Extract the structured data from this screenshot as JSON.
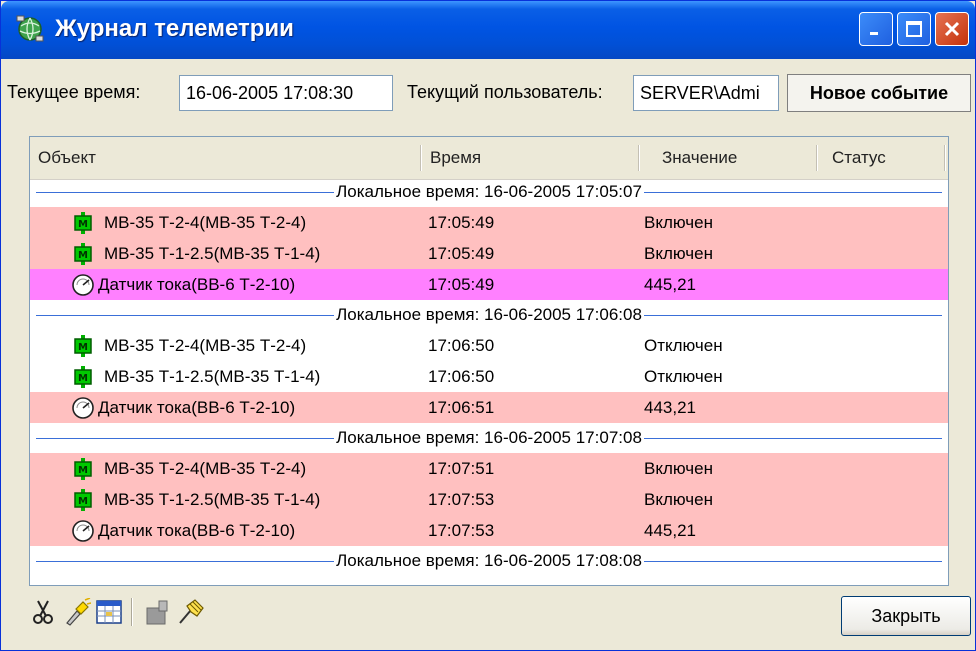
{
  "window": {
    "title": "Журнал телеметрии",
    "icons": {
      "app": "globe-network-icon",
      "minimize": "minimize-icon",
      "maximize": "maximize-icon",
      "close": "close-x-icon"
    }
  },
  "top": {
    "current_time_label": "Текущее время:",
    "current_time_value": "16-06-2005 17:08:30",
    "current_user_label": "Текущий пользователь:",
    "current_user_value": "SERVER\\Admi",
    "new_event_label": "Новое событие"
  },
  "columns": [
    "Объект",
    "Время",
    "Значение",
    "Статус"
  ],
  "separators": [
    "Локальное время: 16-06-2005 17:05:07",
    "Локальное время: 16-06-2005 17:06:08",
    "Локальное время: 16-06-2005 17:07:08",
    "Локальное время: 16-06-2005 17:08:08"
  ],
  "rows": [
    {
      "object": "МВ-35 Т-2-4(МВ-35 Т-2-4)",
      "time": "17:05:49",
      "value": "Включен",
      "status": "",
      "icon": "switch-icon",
      "bg": "#ffc0c0"
    },
    {
      "object": "МВ-35 Т-1-2.5(МВ-35 Т-1-4)",
      "time": "17:05:49",
      "value": "Включен",
      "status": "",
      "icon": "switch-icon",
      "bg": "#ffc0c0"
    },
    {
      "object": "Датчик тока(ВВ-6 Т-2-10)",
      "time": "17:05:49",
      "value": "445,21",
      "status": "",
      "icon": "gauge-icon",
      "bg": "#ff80ff"
    },
    {
      "object": "МВ-35 Т-2-4(МВ-35 Т-2-4)",
      "time": "17:06:50",
      "value": "Отключен",
      "status": "",
      "icon": "switch-icon",
      "bg": "#ffffff"
    },
    {
      "object": "МВ-35 Т-1-2.5(МВ-35 Т-1-4)",
      "time": "17:06:50",
      "value": "Отключен",
      "status": "",
      "icon": "switch-icon",
      "bg": "#ffffff"
    },
    {
      "object": "Датчик тока(ВВ-6 Т-2-10)",
      "time": "17:06:51",
      "value": "443,21",
      "status": "",
      "icon": "gauge-icon",
      "bg": "#ffc0c0"
    },
    {
      "object": "МВ-35 Т-2-4(МВ-35 Т-2-4)",
      "time": "17:07:51",
      "value": "Включен",
      "status": "",
      "icon": "switch-icon",
      "bg": "#ffc0c0"
    },
    {
      "object": "МВ-35 Т-1-2.5(МВ-35 Т-1-4)",
      "time": "17:07:53",
      "value": "Включен",
      "status": "",
      "icon": "switch-icon",
      "bg": "#ffc0c0"
    },
    {
      "object": "Датчик тока(ВВ-6 Т-2-10)",
      "time": "17:07:53",
      "value": "445,21",
      "status": "",
      "icon": "gauge-icon",
      "bg": "#ffc0c0"
    }
  ],
  "toolbar": {
    "icons": [
      "scissors-icon",
      "flashlight-icon",
      "table-icon",
      "key-icon",
      "settings-hand-icon"
    ],
    "close_label": "Закрыть"
  },
  "colors": {
    "title_bar": "#0054e3",
    "row_pink": "#ffc0c0",
    "row_magenta": "#ff80ff",
    "separator_line": "#3a6fd8"
  }
}
